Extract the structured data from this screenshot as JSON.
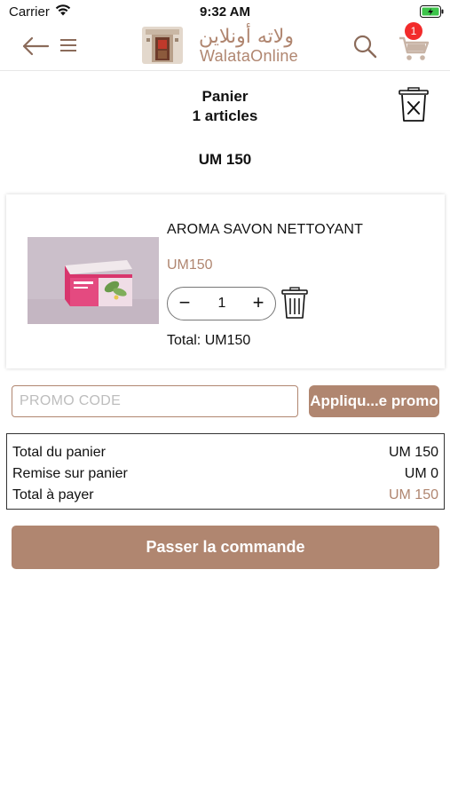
{
  "status_bar": {
    "carrier": "Carrier",
    "time": "9:32 AM",
    "wifi_icon": "wifi-icon",
    "battery_icon": "battery-charging-icon"
  },
  "navbar": {
    "back_icon": "arrow-left-icon",
    "menu_icon": "hamburger-menu-icon",
    "logo_arabic": "ولاته أونلاين",
    "logo_latin": "WalataOnline",
    "search_icon": "search-icon",
    "cart_icon": "shopping-cart-icon",
    "cart_badge": "1"
  },
  "cart": {
    "title": "Panier",
    "count_label": "1 articles",
    "subtotal": "UM 150",
    "clear_icon": "trash-x-icon"
  },
  "items": [
    {
      "name": "AROMA SAVON NETTOYANT",
      "price": "UM150",
      "quantity": "1",
      "minus": "−",
      "plus": "+",
      "total": "Total: UM150",
      "delete_icon": "trash-icon"
    }
  ],
  "promo": {
    "placeholder": "PROMO CODE",
    "value": "",
    "button_label": "Appliqu...e promo"
  },
  "summary": {
    "cart_total_label": "Total du panier",
    "cart_total_value": "UM 150",
    "discount_label": "Remise sur panier",
    "discount_value": "UM 0",
    "to_pay_label": "Total à payer",
    "to_pay_value": "UM 150"
  },
  "checkout": {
    "button_label": "Passer la commande"
  },
  "colors": {
    "accent": "#b08670",
    "badge": "#f22b2b",
    "text": "#111111"
  }
}
